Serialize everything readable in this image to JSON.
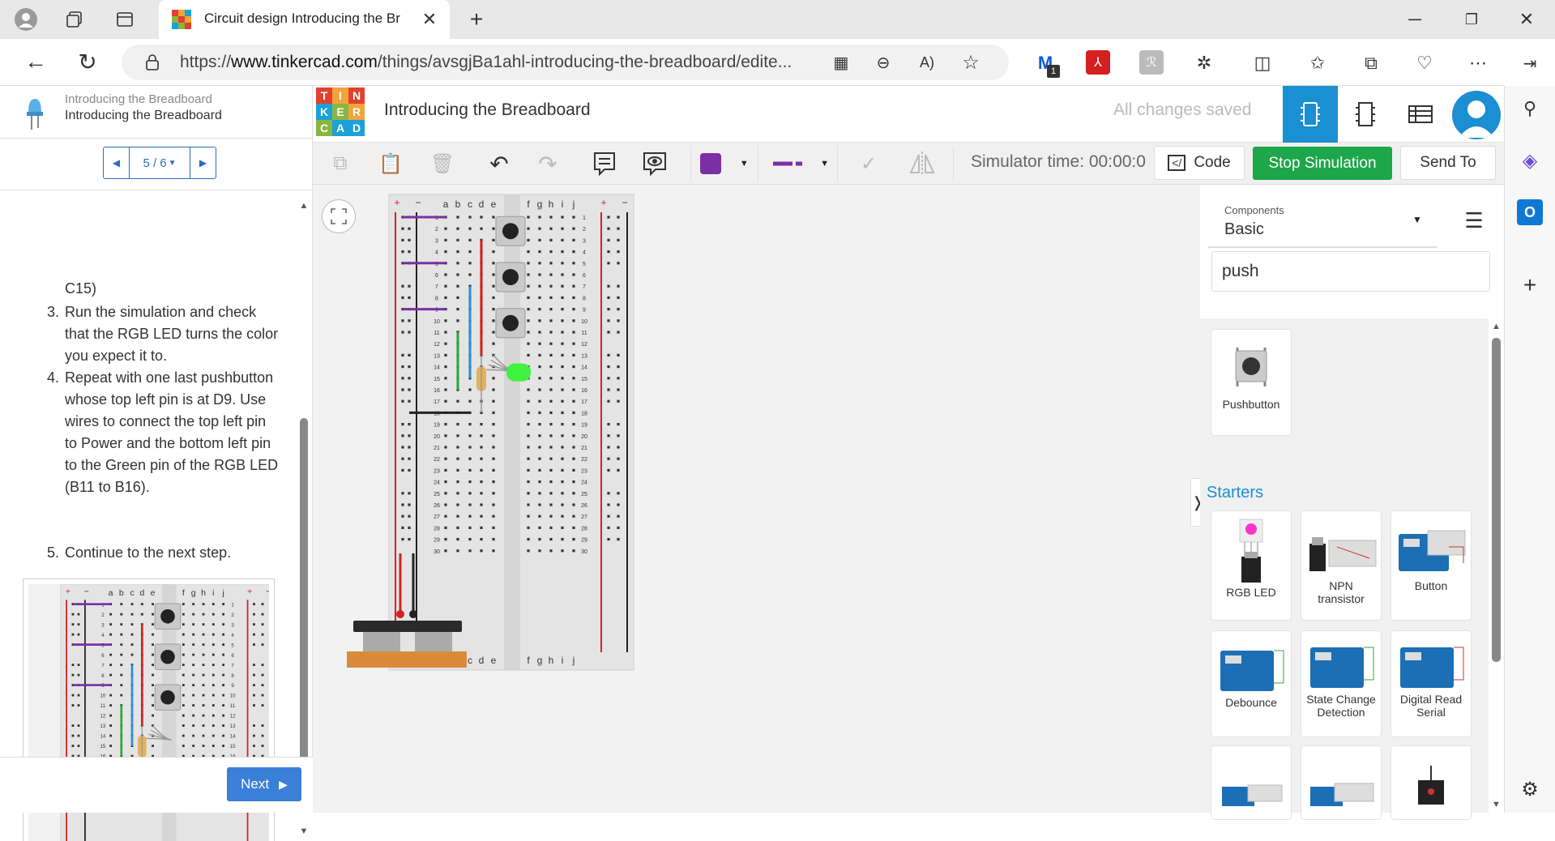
{
  "browser": {
    "tab_title": "Circuit design Introducing the Br",
    "url_prefix": "https://",
    "url_host": "www.tinkercad.com",
    "url_path": "/things/avsgjBa1ahl-introducing-the-breadboard/edite...",
    "ext_badge": "1"
  },
  "lesson": {
    "category": "Introducing the Breadboard",
    "title": "Introducing the Breadboard",
    "pager": "5 / 6",
    "text_fragment": "C15)",
    "steps": [
      {
        "num": "3.",
        "text": "Run the simulation and check that the RGB LED turns the color you expect it to."
      },
      {
        "num": "4.",
        "text": "Repeat with one last pushbutton whose top left pin is at D9. Use wires to connect the top left pin to Power and the bottom left pin to the Green pin of the RGB LED (B11 to B16)."
      },
      {
        "num": "5.",
        "text": "Continue to the next step."
      }
    ],
    "next_label": "Next"
  },
  "header": {
    "logo_letters": [
      "T",
      "I",
      "N",
      "K",
      "E",
      "R",
      "C",
      "A",
      "D"
    ],
    "design_title": "Introducing the Breadboard",
    "save_status": "All changes saved"
  },
  "toolbar": {
    "sim_time": "Simulator time: 00:00:0",
    "code_label": "Code",
    "stop_label": "Stop Simulation",
    "send_label": "Send To",
    "fill_color": "#7b2fa4",
    "wire_color": "#7b2fa4"
  },
  "panel": {
    "components_label": "Components",
    "components_value": "Basic",
    "search_value": "push",
    "results": [
      {
        "label": "Pushbutton"
      }
    ],
    "starters_label": "Starters",
    "starters": [
      {
        "label": "RGB LED"
      },
      {
        "label": "NPN transistor"
      },
      {
        "label": "Button"
      },
      {
        "label": "Debounce"
      },
      {
        "label": "State Change Detection"
      },
      {
        "label": "Digital Read Serial"
      }
    ]
  },
  "breadboard": {
    "columns_left": [
      "a",
      "b",
      "c",
      "d",
      "e"
    ],
    "columns_right": [
      "f",
      "g",
      "h",
      "i",
      "j"
    ],
    "rows": 30,
    "plus": "+",
    "minus": "−",
    "colors": {
      "accent": "#1a8fd1",
      "stop": "#1da64a",
      "power": "#d42020",
      "ground": "#222222",
      "purple": "#7b2fa4",
      "blue": "#2a8fd0",
      "green": "#27a937",
      "led": "#3ff23f"
    }
  }
}
